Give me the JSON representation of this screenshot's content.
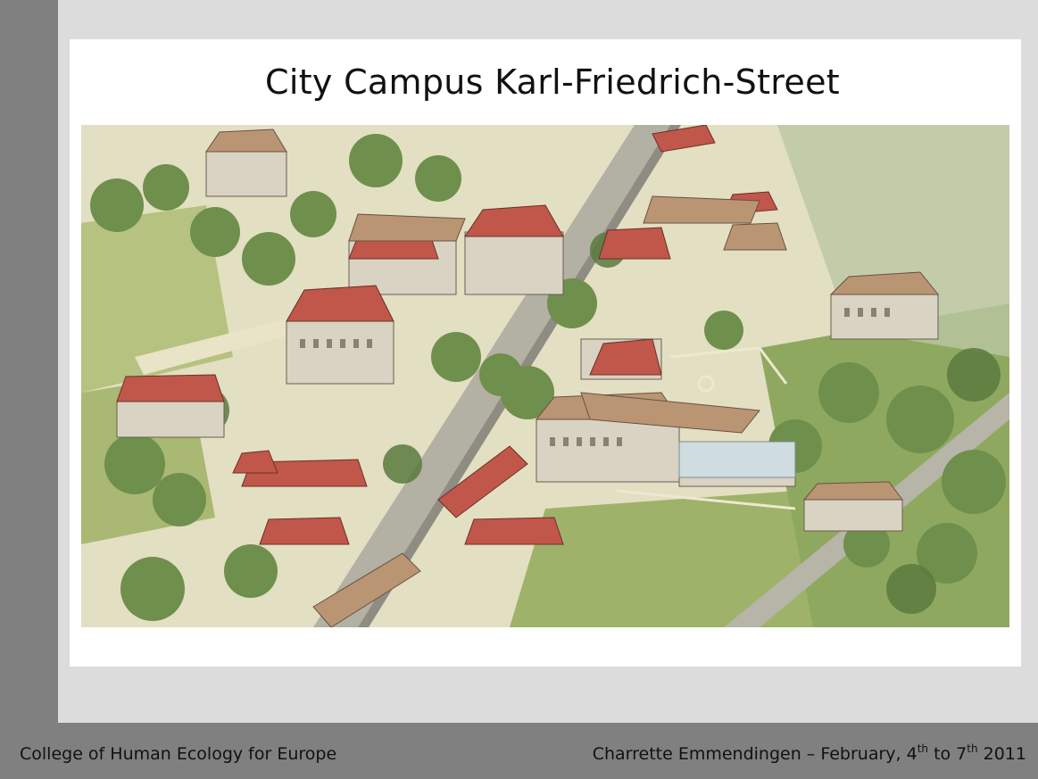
{
  "slide": {
    "title": "City Campus Karl-Friedrich-Street",
    "illustration_label": "watercolor aerial view of the city campus"
  },
  "footer": {
    "left_text": "College of Human Ecology for Europe",
    "right_prefix": "Charrette Emmendingen – February, 4",
    "right_sup1": "th",
    "right_mid": " to 7",
    "right_sup2": "th",
    "right_suffix": " 2011"
  },
  "colors": {
    "side_bar": "#808080",
    "background": "#dcdcdc",
    "panel": "#ffffff",
    "roof_red": "#c0574a",
    "roof_tan": "#b99574",
    "tree_green": "#6f8f4c",
    "lawn_green": "#a9b872",
    "street_gray": "#a6a49a"
  }
}
